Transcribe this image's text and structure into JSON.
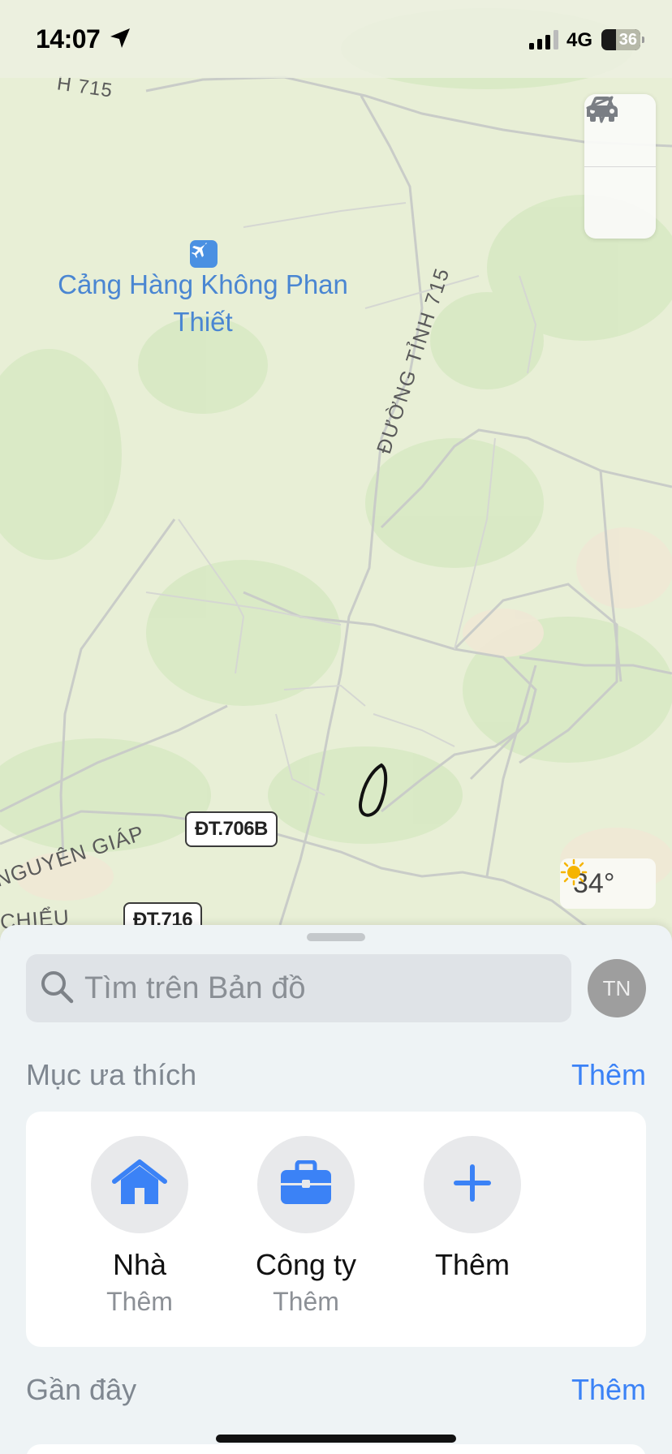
{
  "status_bar": {
    "time": "14:07",
    "network": "4G",
    "battery": "36"
  },
  "map": {
    "airport_name": "Cảng Hàng Không Phan Thiết",
    "road_top": "H 715",
    "road_vertical": "ĐƯỜNG TỈNH 715",
    "road_bottom_left": "NGUYÊN GIÁP",
    "road_bottom_left2": "CHIỂU",
    "shield_1": "ĐT.706B",
    "shield_2": "ĐT.716",
    "weather_temp": "34°"
  },
  "sheet": {
    "search_placeholder": "Tìm trên Bản đồ",
    "avatar_initials": "TN",
    "favorites_title": "Mục ưa thích",
    "favorites_more": "Thêm",
    "favorites": [
      {
        "title": "Nhà",
        "subtitle": "Thêm",
        "icon": "house-icon"
      },
      {
        "title": "Công ty",
        "subtitle": "Thêm",
        "icon": "briefcase-icon"
      },
      {
        "title": "Thêm",
        "subtitle": "",
        "icon": "plus-icon"
      }
    ],
    "recents_title": "Gần đây",
    "recents_more": "Thêm"
  },
  "colors": {
    "accent": "#3b82f6",
    "map_bg": "#e8efd6",
    "airport_label": "#4a86d2"
  }
}
